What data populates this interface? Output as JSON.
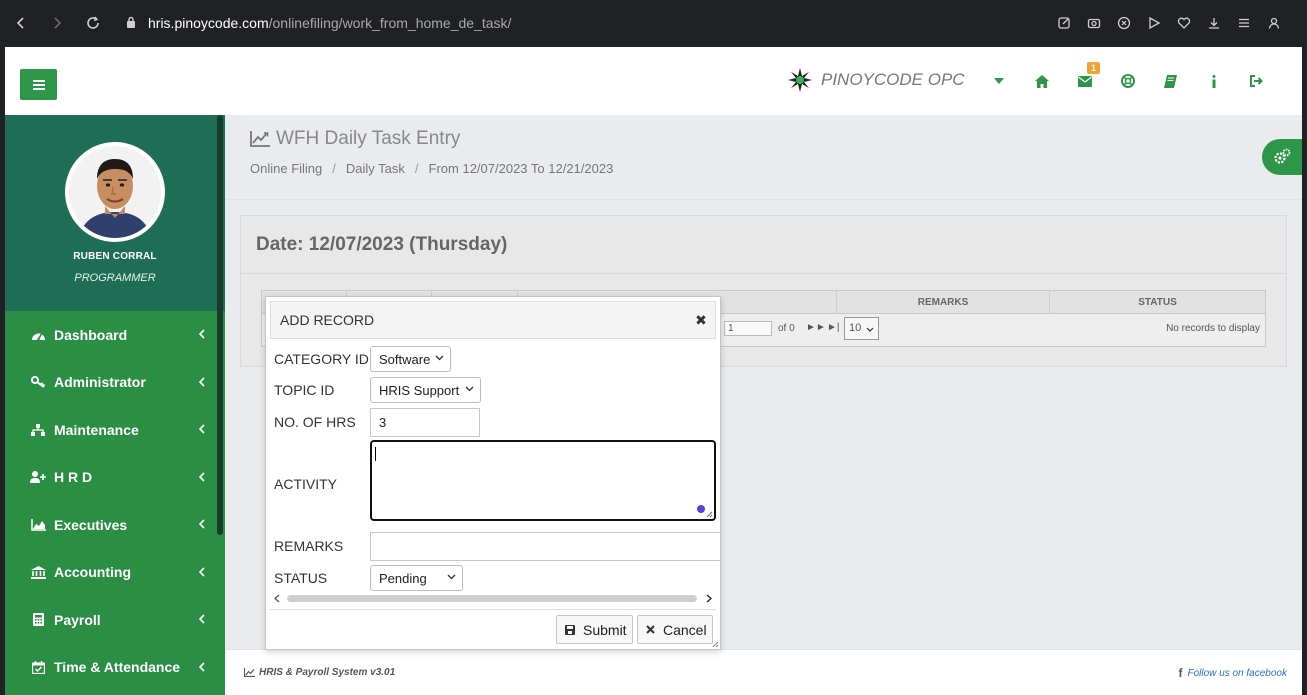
{
  "browser": {
    "url_host": "hris.pinoycode.com",
    "url_path": "/onlinefiling/work_from_home_de_task/"
  },
  "header": {
    "brand": "PINOYCODE OPC",
    "mail_badge": "1"
  },
  "user": {
    "name": "RUBEN CORRAL",
    "role": "PROGRAMMER"
  },
  "sidebar": {
    "items": [
      {
        "label": "Dashboard"
      },
      {
        "label": "Administrator"
      },
      {
        "label": "Maintenance"
      },
      {
        "label": "H R D"
      },
      {
        "label": "Executives"
      },
      {
        "label": "Accounting"
      },
      {
        "label": "Payroll"
      },
      {
        "label": "Time & Attendance"
      }
    ]
  },
  "page": {
    "title": "WFH Daily Task Entry",
    "breadcrumb": [
      "Online Filing",
      "Daily Task",
      "From 12/07/2023 To 12/21/2023"
    ],
    "panel_title": "Date: 12/07/2023 (Thursday)"
  },
  "grid": {
    "columns": [
      "REMARKS",
      "STATUS"
    ],
    "page_input": "1",
    "page_of": "of 0",
    "page_size": "10",
    "empty_text": "No records to display"
  },
  "modal": {
    "title": "ADD RECORD",
    "fields": {
      "category": {
        "label": "CATEGORY ID",
        "value": "Software"
      },
      "topic": {
        "label": "TOPIC ID",
        "value": "HRIS Support"
      },
      "hours": {
        "label": "NO. OF HRS",
        "value": "3"
      },
      "activity": {
        "label": "ACTIVITY",
        "value": ""
      },
      "remarks": {
        "label": "REMARKS",
        "value": ""
      },
      "status": {
        "label": "STATUS",
        "value": "Pending"
      }
    },
    "submit_label": "Submit",
    "cancel_label": "Cancel"
  },
  "footer": {
    "version": "HRIS & Payroll System v3.01",
    "facebook": "Follow us on facebook"
  },
  "colors": {
    "primary_green": "#2e9648",
    "sidebar_green": "#2b8e45",
    "profile_teal": "#1d6e55",
    "badge_orange": "#f0a235",
    "link_blue": "#2c6fcf"
  }
}
